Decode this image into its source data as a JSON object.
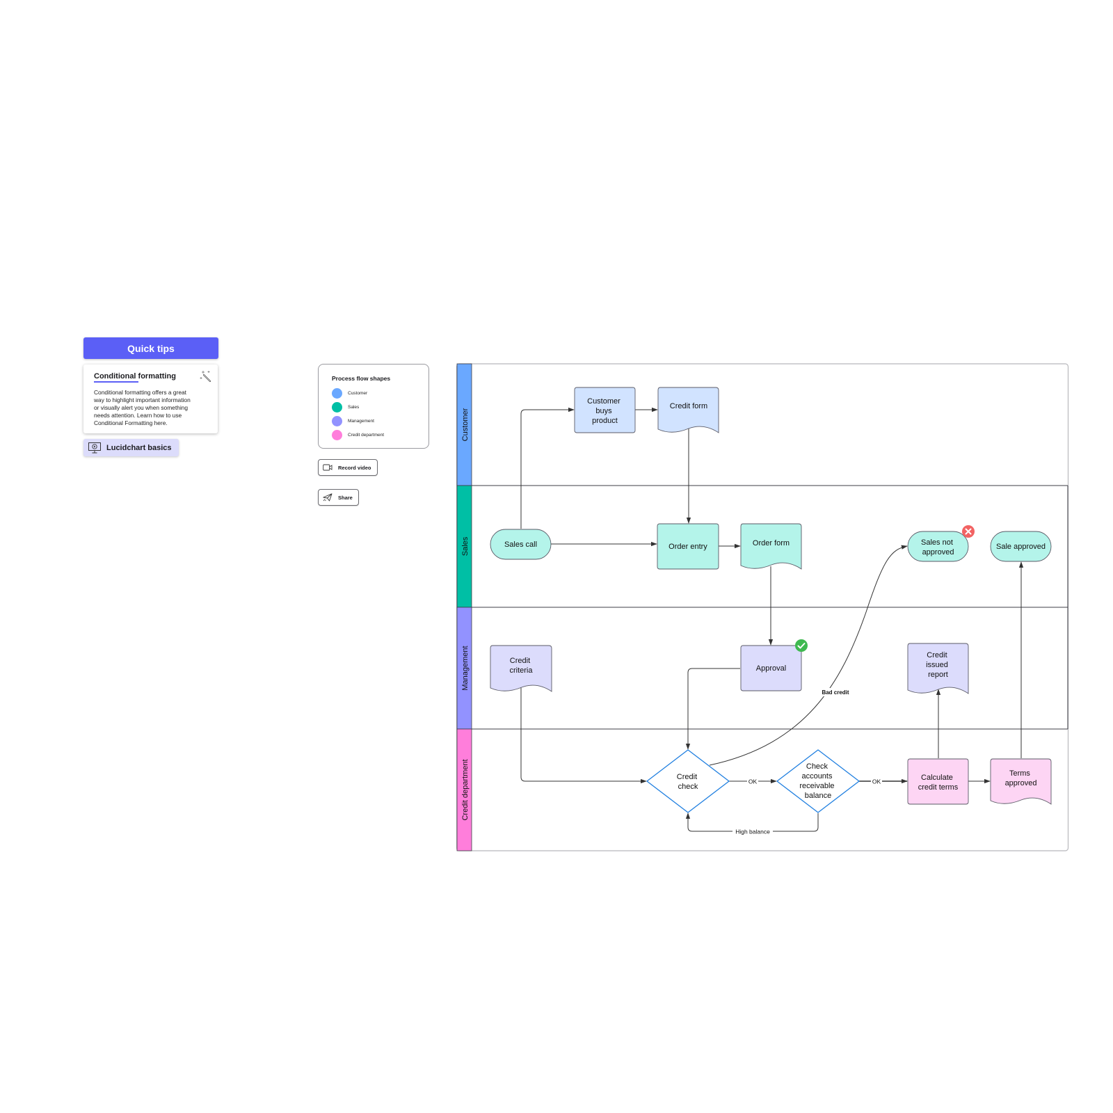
{
  "quick_tips": {
    "header": "Quick tips",
    "card_title": "Conditional formatting",
    "card_body_lines": [
      "Conditional formatting offers a great",
      "way to highlight important information",
      "or visually alert you when something",
      "needs attention. Learn how to use",
      "Conditional Formatting here."
    ],
    "card_icon": "magic-wand-icon",
    "basics_label": "Lucidchart basics",
    "basics_icon": "video-monitor-icon"
  },
  "legend": {
    "title": "Process flow shapes",
    "items": [
      {
        "label": "Customer",
        "color": "#6aa8ff"
      },
      {
        "label": "Sales",
        "color": "#00bfa5"
      },
      {
        "label": "Management",
        "color": "#9292ff"
      },
      {
        "label": "Credit department",
        "color": "#ff7edb"
      }
    ]
  },
  "actions": {
    "record_video": "Record video",
    "record_icon": "video-camera-icon",
    "share": "Share",
    "share_icon": "paper-plane-icon"
  },
  "swimlanes": [
    {
      "label": "Customer",
      "color": "#6aa8ff"
    },
    {
      "label": "Sales",
      "color": "#00bfa5"
    },
    {
      "label": "Management",
      "color": "#9292ff"
    },
    {
      "label": "Credit department",
      "color": "#ff7edb"
    }
  ],
  "shape_fills": {
    "customer": "#d1e3ff",
    "sales": "#b4f4ea",
    "management": "#dcdcfc",
    "credit": "#fdd5f4",
    "decision_stroke": "#1f7fe0"
  },
  "nodes": {
    "customer_buys": [
      "Customer",
      "buys",
      "product"
    ],
    "credit_form": [
      "Credit form"
    ],
    "sales_call": [
      "Sales call"
    ],
    "order_entry": [
      "Order entry"
    ],
    "order_form": [
      "Order form"
    ],
    "sales_not_approved": [
      "Sales not",
      "approved"
    ],
    "sale_approved": [
      "Sale approved"
    ],
    "credit_criteria": [
      "Credit",
      "criteria"
    ],
    "approval": [
      "Approval"
    ],
    "credit_issued_report": [
      "Credit",
      "issued",
      "report"
    ],
    "credit_check": [
      "Credit",
      "check"
    ],
    "check_ar_balance": [
      "Check",
      "accounts",
      "receivable",
      "balance"
    ],
    "calculate_terms": [
      "Calculate",
      "credit terms"
    ],
    "terms_approved": [
      "Terms",
      "approved"
    ]
  },
  "edge_labels": {
    "ok1": "OK",
    "ok2": "OK",
    "high_balance": "High balance",
    "bad_credit": "Bad credit"
  },
  "badges": {
    "approval": {
      "icon": "check-badge-icon",
      "color": "#3fb950"
    },
    "sales_not_approved": {
      "icon": "x-badge-icon",
      "color": "#f26363"
    }
  }
}
